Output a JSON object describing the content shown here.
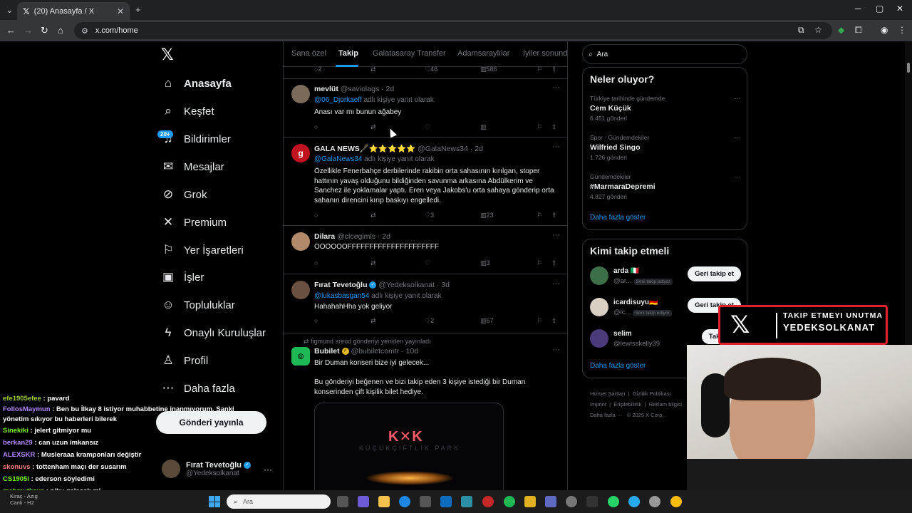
{
  "browser": {
    "tab_title": "(20) Anasayfa / X",
    "url": "x.com/home"
  },
  "nav": {
    "items": [
      {
        "label": "Anasayfa",
        "icon": "home-icon",
        "glyph": "⌂"
      },
      {
        "label": "Keşfet",
        "icon": "search-icon",
        "glyph": "⌕"
      },
      {
        "label": "Bildirimler",
        "icon": "bell-icon",
        "glyph": "♫"
      },
      {
        "label": "Mesajlar",
        "icon": "mail-icon",
        "glyph": "✉"
      },
      {
        "label": "Grok",
        "icon": "grok-icon",
        "glyph": "⊘"
      },
      {
        "label": "Premium",
        "icon": "x-icon",
        "glyph": "✕"
      },
      {
        "label": "Yer İşaretleri",
        "icon": "bookmark-icon",
        "glyph": "⚐"
      },
      {
        "label": "İşler",
        "icon": "briefcase-icon",
        "glyph": "▣"
      },
      {
        "label": "Topluluklar",
        "icon": "people-icon",
        "glyph": "☺"
      },
      {
        "label": "Onaylı Kuruluşlar",
        "icon": "bolt-icon",
        "glyph": "ϟ"
      },
      {
        "label": "Profil",
        "icon": "profile-icon",
        "glyph": "♙"
      },
      {
        "label": "Daha fazla",
        "icon": "more-circle-icon",
        "glyph": "⋯"
      }
    ],
    "notifications_badge": "20+",
    "post_button": "Gönderi yayınla",
    "account": {
      "name": "Fırat Tevetoğlu",
      "handle": "@Yedeksolkanat"
    }
  },
  "chat": [
    {
      "user": "efe1905efee",
      "color": "#9acd32",
      "text": " : pavard"
    },
    {
      "user": "FollosMaymun",
      "color": "#b388ff",
      "text": " : Ben bu İlkay 8 istiyor muhabbetine inanmıyorum. Sanki yönetim sıkıyor bu haberleri bilerek"
    },
    {
      "user": "Sinekiki",
      "color": "#7cfc00",
      "text": " : jelert gitmiyor mu"
    },
    {
      "user": "berkan29",
      "color": "#b388ff",
      "text": " : can uzun imkansız"
    },
    {
      "user": "ALEXSKR",
      "color": "#b388ff",
      "text": " : Musleraaa kramponları değiştir"
    },
    {
      "user": "skonuvs",
      "color": "#ff7f7f",
      "text": " : tottenham maçı der susarım"
    },
    {
      "user": "CS1905i",
      "color": "#7cfc00",
      "text": " : ederson söyledimi"
    },
    {
      "user": "mahmutkaya",
      "color": "#7cfc00",
      "text": " : niku gelecek mi"
    }
  ],
  "timeline": {
    "tabs": [
      "Sana özel",
      "Takip",
      "Galatasaray Transfer",
      "Adamsaraylılar",
      "İyiler sonunda"
    ],
    "prev_counts": {
      "reply": "2",
      "like": "46",
      "views": "586"
    },
    "tweets": [
      {
        "name": "mevlüt",
        "handle": "@saviolags",
        "time": "· 2d",
        "reply_mention": "@06_Djorkaeff",
        "reply_suffix": " adlı kişiye yanıt olarak",
        "body": "Anası var mı bunun ağabey",
        "like": "",
        "views": ""
      },
      {
        "name": "GALA NEWS🖋️⭐⭐⭐⭐⭐",
        "handle": "@GalaNews34",
        "time": "· 2d",
        "reply_mention": "@GalaNews34",
        "reply_suffix": " adlı kişiye yanıt olarak",
        "body": "Özellikle Fenerbahçe derbilerinde rakibin orta sahasının kırılgan, stoper hattının yavaş olduğunu bildiğinden savunma arkasına Abdülkerim ve Sanchez ile yoklamalar yaptı. Eren veya Jakobs'u orta sahaya gönderip orta sahanın direncini kırıp baskıyı engelledi.",
        "like": "3",
        "views": "23"
      },
      {
        "name": "Dilara",
        "handle": "@clcegimls",
        "time": "· 2d",
        "reply_mention": "",
        "reply_suffix": "",
        "body": "OOOOOOFFFFFFFFFFFFFFFFFFFFF",
        "like": "",
        "views": "3"
      },
      {
        "name": "Fırat Tevetoğlu",
        "handle": "@Yedeksolkanat",
        "time": "· 3d",
        "reply_mention": "@lukasbasgan54",
        "reply_suffix": " adlı kişiye yanıt olarak",
        "body": "HahahahHha yok geliyor",
        "like": "2",
        "views": "67"
      },
      {
        "repost_by": "figmund sreud gönderiyi yeniden yayınladı",
        "name": "Bubilet",
        "handle": "@bubiletcomtr",
        "time": "· 10d",
        "body1": "Bir Duman konseri bize iyi gelecek...",
        "body2": "Bu gönderiyi beğenen ve bizi takip eden 3 kişiye istediği bir Duman konserinden çift kişilik bilet hediye.",
        "image_logo": "K✕K",
        "image_text": "KÜÇÜKÇİFTLİK PARK"
      }
    ]
  },
  "right": {
    "search_placeholder": "Ara",
    "trends_title": "Neler oluyor?",
    "trends": [
      {
        "context": "Türkiye tarihinde gündemde",
        "title": "Cem Küçük",
        "count": "6.451 gönderi"
      },
      {
        "context": "Spor · Gündemdekiler",
        "title": "Wilfried Singo",
        "count": "1.726 gönderi"
      },
      {
        "context": "Gündemdekiler",
        "title": "#MarmaraDepremi",
        "count": "4.827 gönderi"
      }
    ],
    "trends_more": "Daha fazla göster",
    "who_title": "Kimi takip etmeli",
    "who": [
      {
        "name": "arda 🇮🇹",
        "handle": "@ar...",
        "follows_you": "Seni takip ediyor",
        "button": "Geri takip et"
      },
      {
        "name": "icardisuyu🇩🇪",
        "handle": "@ic...",
        "follows_you": "Seni takip ediyor",
        "button": "Geri takip et"
      },
      {
        "name": "selim",
        "handle": "@lewisskelly39",
        "follows_you": "",
        "button": "Takip et"
      }
    ],
    "who_more": "Daha fazla göster",
    "footer": [
      "Hizmet Şartları",
      "Gizlilik Politikası",
      "Imprint",
      "Erişilebilirlik",
      "Reklam bilgisi",
      "Daha fazla ···",
      "© 2025 X Corp."
    ]
  },
  "overlay": {
    "line1": "TAKIP ETMEYI UNUTMA",
    "line2": "YEDEKSOLKANAT"
  },
  "taskbar": {
    "search": "Ara",
    "spotify_line1": "Kıraç - Azıg",
    "spotify_line2": "Canlı - H2"
  }
}
